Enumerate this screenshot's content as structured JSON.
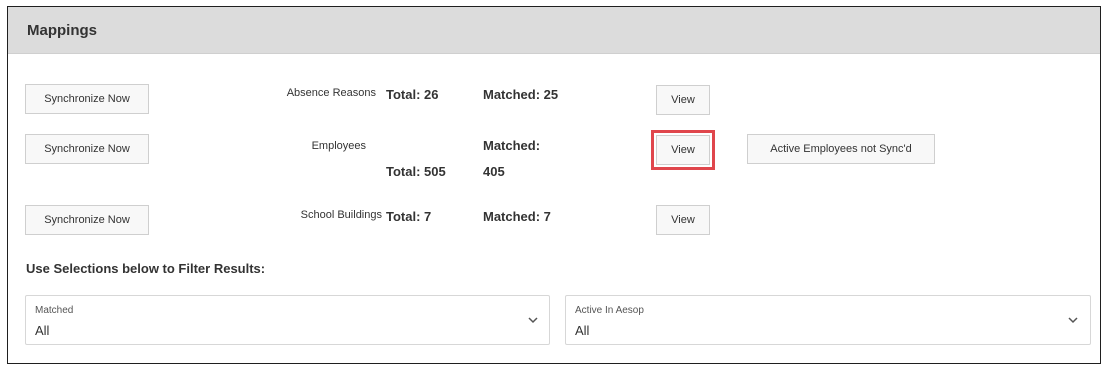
{
  "panel": {
    "title": "Mappings"
  },
  "rows": [
    {
      "sync_label": "Synchronize Now",
      "name": "Absence Reasons",
      "total": "Total: 26",
      "matched": "Matched: 25",
      "view_label": "View"
    },
    {
      "sync_label": "Synchronize Now",
      "name": "Employees",
      "total": "Total: 505",
      "matched_label": "Matched:",
      "matched_value": "405",
      "view_label": "View",
      "extra_label": "Active Employees not Sync'd"
    },
    {
      "sync_label": "Synchronize Now",
      "name": "School Buildings",
      "total": "Total: 7",
      "matched": "Matched: 7",
      "view_label": "View"
    }
  ],
  "filters": {
    "title": "Use Selections below to Filter Results:",
    "matched": {
      "label": "Matched",
      "value": "All"
    },
    "active": {
      "label": "Active In Aesop",
      "value": "All"
    }
  },
  "colors": {
    "header_bg": "#dcdcdc",
    "highlight": "#e0464c",
    "button_bg": "#f8f8f8"
  }
}
